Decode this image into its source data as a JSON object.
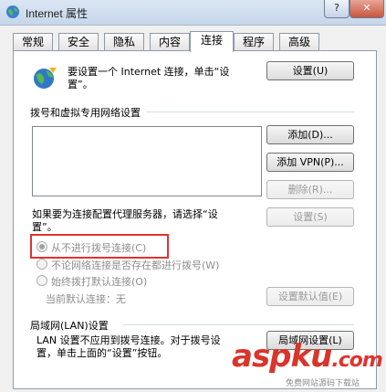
{
  "window": {
    "title": "Internet 属性",
    "help_label": "?",
    "close_label": "✕"
  },
  "tabs": [
    {
      "label": "常规"
    },
    {
      "label": "安全"
    },
    {
      "label": "隐私"
    },
    {
      "label": "内容"
    },
    {
      "label": "连接"
    },
    {
      "label": "程序"
    },
    {
      "label": "高级"
    }
  ],
  "active_tab": "连接",
  "setup": {
    "text_line1": "要设置一个 Internet 连接，单击“设",
    "text_line2": "置”。",
    "button": "设置(U)"
  },
  "dialup": {
    "heading": "拨号和虚拟专用网络设置",
    "add_button": "添加(D)...",
    "add_vpn_button": "添加 VPN(P)...",
    "delete_button": "删除(R)...",
    "proxy_text_line1": "如果要为连接配置代理服务器，请选择“设",
    "proxy_text_line2": "置”。",
    "settings_button": "设置(S)",
    "radio_never": "从不进行拨号连接(C)",
    "radio_whenever": "不论网络连接是否存在都进行拨号(W)",
    "radio_always": "始终拨打默认连接(O)",
    "current_default": "当前默认连接：无",
    "set_default_button": "设置默认值(E)"
  },
  "lan": {
    "heading": "局域网(LAN)设置",
    "text_line1": "LAN 设置不应用到拨号连接。对于拨号设",
    "text_line2": "置，单击上面的“设置”按钮。",
    "button": "局域网设置(L)"
  },
  "watermark": {
    "main": "aspku",
    "suffix": ".com",
    "sub": "免费网站源码下载站"
  },
  "colors": {
    "highlight_box": "#e0332f",
    "watermark": "#d9352b"
  }
}
